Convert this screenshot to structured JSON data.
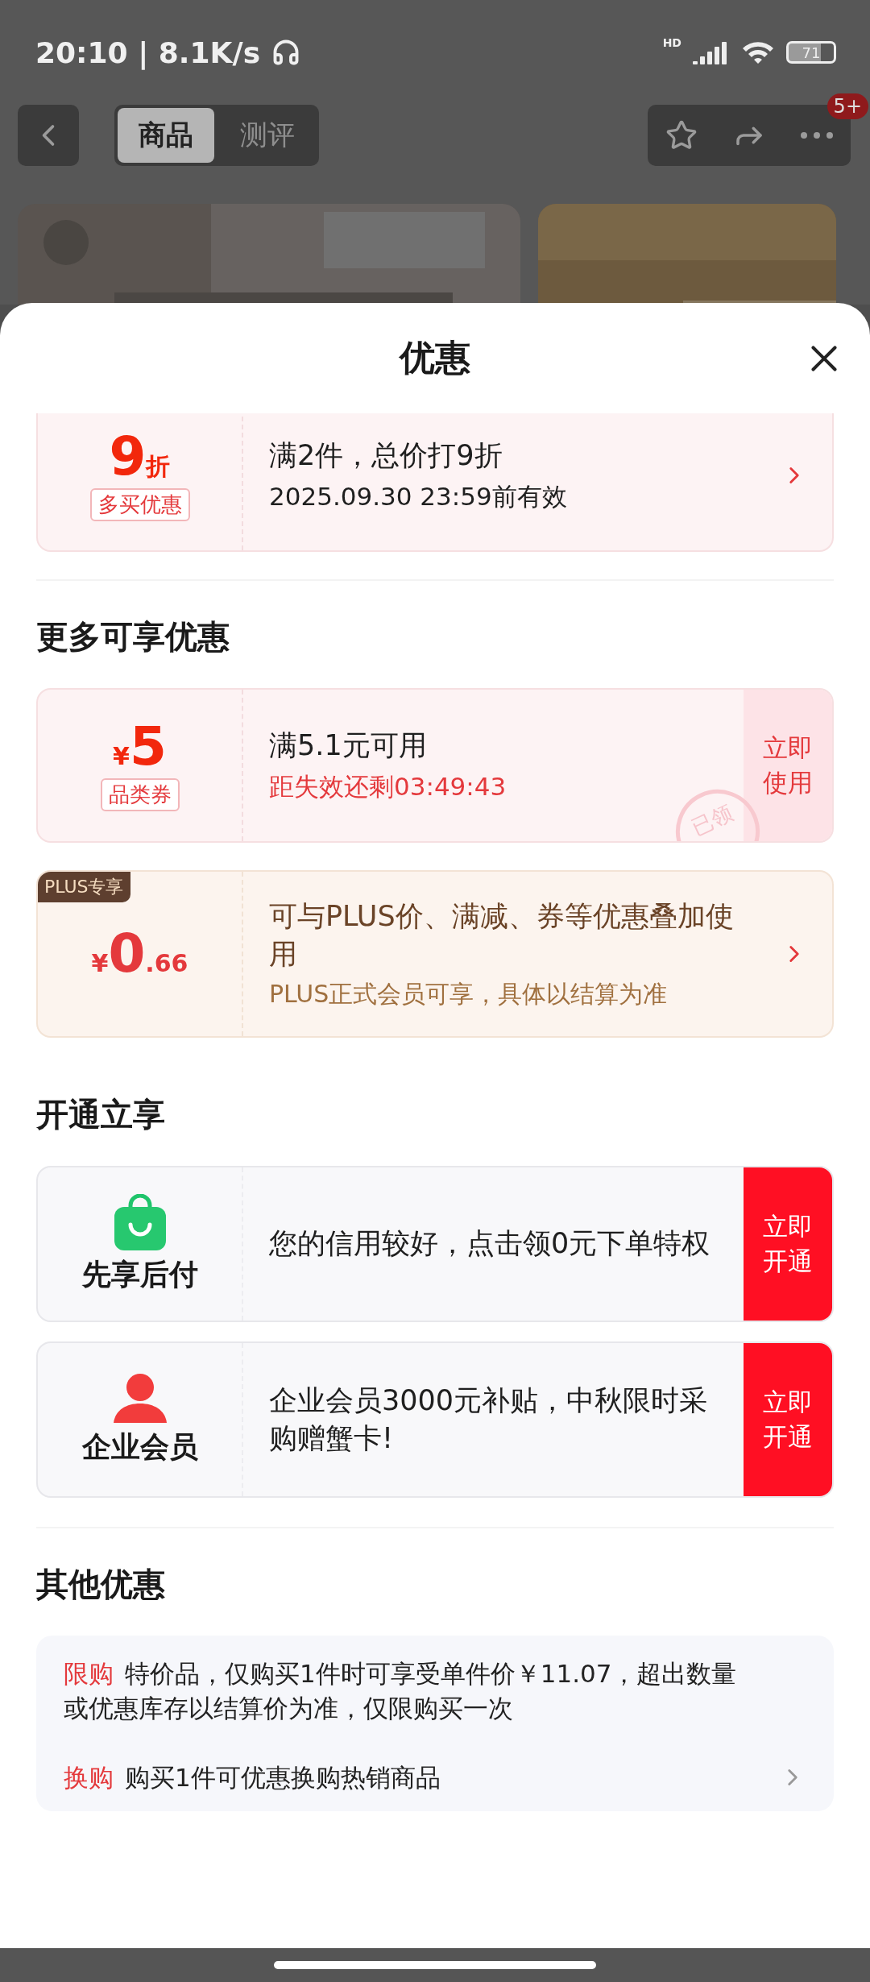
{
  "status_bar": {
    "time": "20:10 | 8.1K/s",
    "network": "HD",
    "battery": "71"
  },
  "header": {
    "tabs": [
      {
        "label": "商品",
        "selected": true
      },
      {
        "label": "测评",
        "selected": false
      }
    ],
    "badge": "5+"
  },
  "sheet": {
    "title": "优惠"
  },
  "current_offer": {
    "value": "9",
    "unit": "折",
    "tag": "多买优惠",
    "title": "满2件，总价打9折",
    "subtitle": "2025.09.30 23:59前有效"
  },
  "more_offers": {
    "heading": "更多可享优惠",
    "coupon": {
      "currency": "¥",
      "amount": "5",
      "tag": "品类券",
      "title": "满5.1元可用",
      "countdown": "距失效还剩03:49:43",
      "stamp": "已领",
      "action": "立即使用"
    },
    "plus": {
      "badge": "PLUS专享",
      "currency": "¥",
      "amount": "0",
      "decimal": ".66",
      "title": "可与PLUS价、满减、券等优惠叠加使用",
      "note": "PLUS正式会员可享，具体以结算为准"
    }
  },
  "activate": {
    "heading": "开通立享",
    "items": [
      {
        "kind": "bag",
        "label": "先享后付",
        "text": "您的信用较好，点击领0元下单特权",
        "action": "立即开通"
      },
      {
        "kind": "person",
        "label": "企业会员",
        "text": "企业会员3000元补贴，中秋限时采购赠蟹卡!",
        "action": "立即开通"
      }
    ]
  },
  "other": {
    "heading": "其他优惠",
    "items": [
      {
        "kind": "info",
        "label": "限购",
        "text": "特价品，仅购买1件时可享受单件价￥11.07，超出数量或优惠库存以结算价为准，仅限购买一次"
      },
      {
        "kind": "link",
        "label": "换购",
        "text": "购买1件可优惠换购热销商品"
      }
    ]
  }
}
